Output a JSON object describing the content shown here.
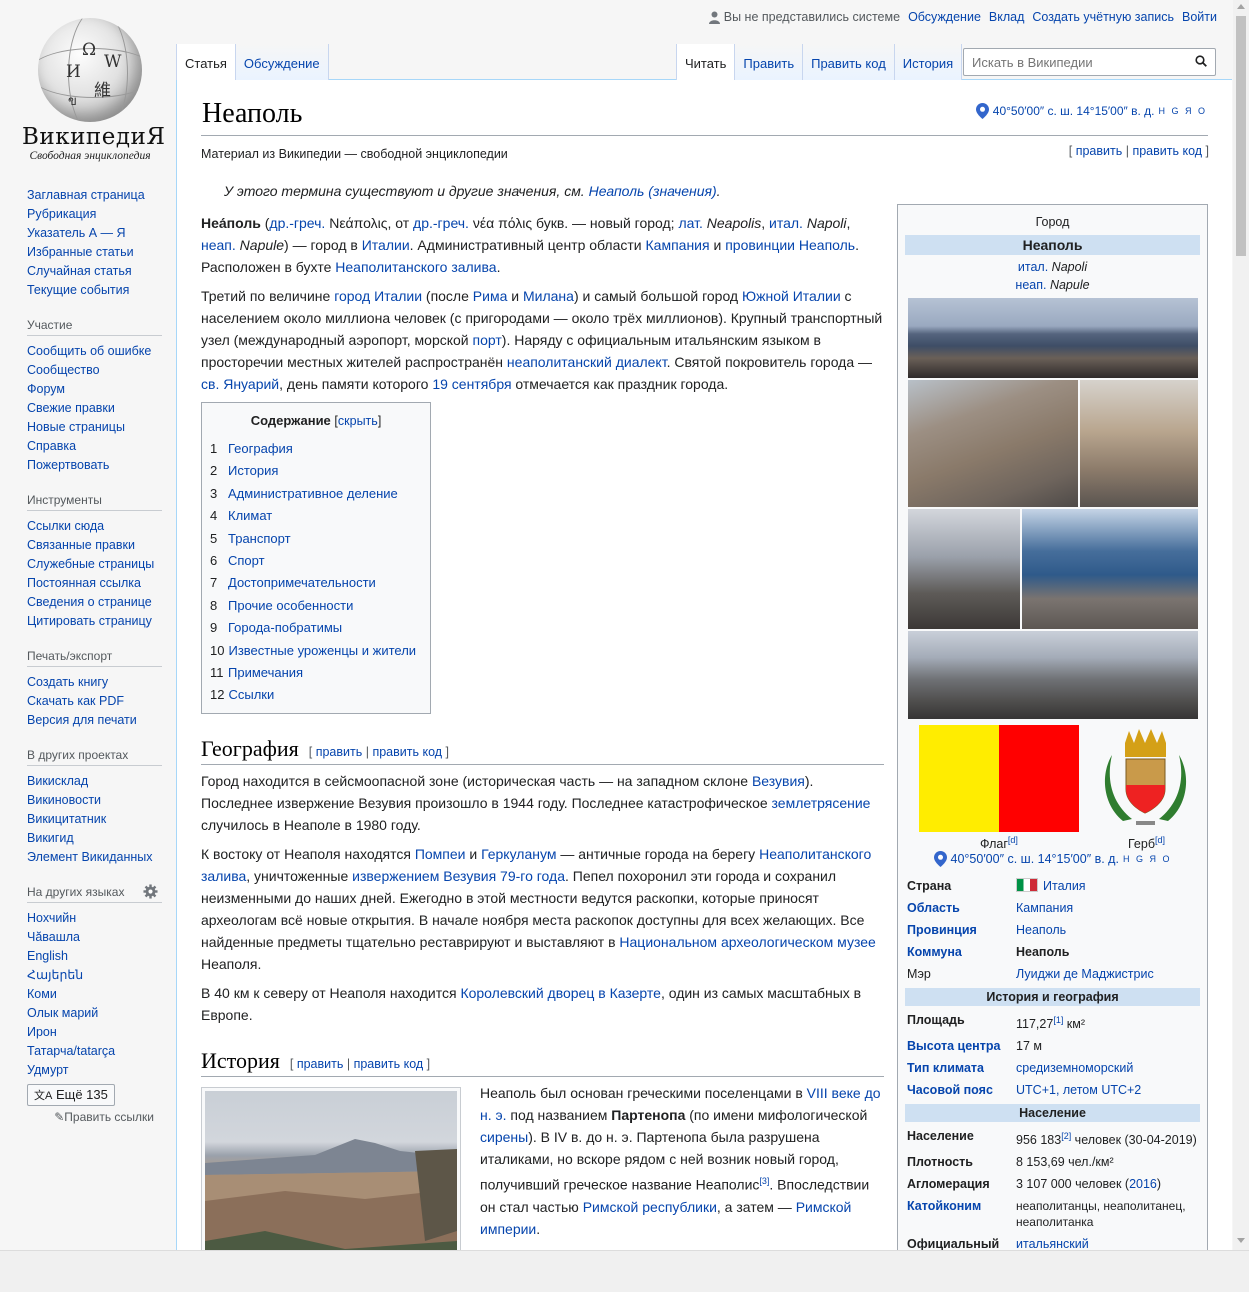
{
  "logo": {
    "wordmark": "ВикипедиЯ",
    "tagline": "Свободная энциклопедия"
  },
  "personal": {
    "not_logged_in": "Вы не представились системе",
    "links": [
      "Обсуждение",
      "Вклад",
      "Создать учётную запись",
      "Войти"
    ]
  },
  "tabs": {
    "article": "Статья",
    "talk": "Обсуждение",
    "read": "Читать",
    "edit": "Править",
    "edit_source": "Править код",
    "history": "История"
  },
  "search": {
    "placeholder": "Искать в Википедии"
  },
  "sidebar": {
    "main": [
      "Заглавная страница",
      "Рубрикация",
      "Указатель А — Я",
      "Избранные статьи",
      "Случайная статья",
      "Текущие события"
    ],
    "participation": {
      "head": "Участие",
      "items": [
        "Сообщить об ошибке",
        "Сообщество",
        "Форум",
        "Свежие правки",
        "Новые страницы",
        "Справка",
        "Пожертвовать"
      ]
    },
    "tools": {
      "head": "Инструменты",
      "items": [
        "Ссылки сюда",
        "Связанные правки",
        "Служебные страницы",
        "Постоянная ссылка",
        "Сведения о странице",
        "Цитировать страницу"
      ]
    },
    "print": {
      "head": "Печать/экспорт",
      "items": [
        "Создать книгу",
        "Скачать как PDF",
        "Версия для печати"
      ]
    },
    "projects": {
      "head": "В других проектах",
      "items": [
        "Викисклад",
        "Викиновости",
        "Викицитатник",
        "Викигид",
        "Элемент Викиданных"
      ]
    },
    "languages": {
      "head": "На других языках",
      "items": [
        "Нохчийн",
        "Чăвашла",
        "English",
        "Հայերեն",
        "Коми",
        "Олык марий",
        "Ирон",
        "Татарча/tatarça",
        "Удмурт"
      ],
      "more": "Ещё 135",
      "edit_links": "Править ссылки"
    }
  },
  "article": {
    "title": "Неаполь",
    "coords": "40°50′00″ с. ш. 14°15′00″ в. д.",
    "coords_sup": "H G Я O",
    "site_sub": "Материал из Википедии — свободной энциклопедии",
    "edit_top": {
      "edit": "править",
      "edit_source": "править код"
    },
    "hatnote_text": "У этого термина существуют и другие значения, см. ",
    "hatnote_link": "Неаполь (значения)",
    "intro": {
      "t0": "Неа́поль",
      "t1": " (",
      "l1": "др.-греч.",
      "t2": " Νεάπολις, от ",
      "l2": "др.-греч.",
      "t3": " νέα πόλις букв. — новый город; ",
      "l3": "лат.",
      "t4": " Neapolis",
      "t5": ", ",
      "l4": "итал.",
      "t6": " Napoli",
      "t7": ", ",
      "l5": "неап.",
      "t8": " Napule",
      "t9": ") — город в ",
      "l6": "Италии",
      "t10": ". Административный центр области ",
      "l7": "Кампания",
      "t11": " и ",
      "l8": "провинции Неаполь",
      "t12": ". Расположен в бухте ",
      "l9": "Неаполитанского залива",
      "t13": "."
    },
    "p2": {
      "t0": "Третий по величине ",
      "l1": "город Италии",
      "t1": " (после ",
      "l2": "Рима",
      "t2": " и ",
      "l3": "Милана",
      "t3": ") и самый большой город ",
      "l4": "Южной Италии",
      "t4": " с населением около миллиона человек (с пригородами — около трёх миллионов). Крупный транспортный узел (международный аэропорт, морской ",
      "l5": "порт",
      "t5": "). Наряду с официальным итальянским языком в просторечии местных жителей распространён ",
      "l6": "неаполитанский диалект",
      "t6": ". Святой покровитель города — ",
      "l7": "св. Януарий",
      "t7": ", день памяти которого ",
      "l8": "19 сентября",
      "t8": " отмечается как праздник города."
    },
    "toc": {
      "title": "Содержание",
      "hide": "скрыть",
      "entries": [
        {
          "n": "1",
          "t": "География"
        },
        {
          "n": "2",
          "t": "История"
        },
        {
          "n": "3",
          "t": "Административное деление"
        },
        {
          "n": "4",
          "t": "Климат"
        },
        {
          "n": "5",
          "t": "Транспорт"
        },
        {
          "n": "6",
          "t": "Спорт"
        },
        {
          "n": "7",
          "t": "Достопримечательности"
        },
        {
          "n": "8",
          "t": "Прочие особенности"
        },
        {
          "n": "9",
          "t": "Города-побратимы"
        },
        {
          "n": "10",
          "t": "Известные уроженцы и жители"
        },
        {
          "n": "11",
          "t": "Примечания"
        },
        {
          "n": "12",
          "t": "Ссылки"
        }
      ]
    },
    "geo": {
      "heading": "География",
      "edit": "править",
      "edit_source": "править код",
      "p1": {
        "t0": "Город находится в сейсмоопасной зоне (историческая часть — на западном склоне ",
        "l1": "Везувия",
        "t1": "). Последнее извержение Везувия произошло в 1944 году. Последнее катастрофическое ",
        "l2": "землетрясение",
        "t2": " случилось в Неаполе в 1980 году."
      },
      "p2": {
        "t0": "К востоку от Неаполя находятся ",
        "l1": "Помпеи",
        "t1": " и ",
        "l2": "Геркуланум",
        "t2": " — античные города на берегу ",
        "l3": "Неаполитанского залива",
        "t3": ", уничтоженные ",
        "l4": "извержением Везувия 79-го года",
        "t4": ". Пепел похоронил эти города и сохранил неизменными до наших дней. Ежегодно в этой местности ведутся раскопки, которые приносят археологам всё новые открытия. В начале ноября места раскопок доступны для всех желающих. Все найденные предметы тщательно реставрируют и выставляют в ",
        "l5": "Национальном археологическом музее",
        "t5": " Неаполя."
      },
      "p3": {
        "t0": "В 40 км к северу от Неаполя находится ",
        "l1": "Королевский дворец в Казерте",
        "t1": ", один из самых масштабных в Европе."
      }
    },
    "history": {
      "heading": "История",
      "edit": "править",
      "edit_source": "править код",
      "p1": {
        "t0": "Неаполь был основан греческими поселенцами в ",
        "l1": "VIII веке до н. э.",
        "t1": " под названием ",
        "b1": "Партенопа",
        "t2": " (по имени мифологической ",
        "l2": "сирены",
        "t3": "). В IV в. до н. э. Партенопа была разрушена италиками, но вскоре рядом с ней возник новый город, получивший греческое название Неаполис",
        "r1": "[3]",
        "t4": ". Впоследствии он стал частью ",
        "l3": "Римской республики",
        "t5": ", а затем — ",
        "l4": "Римской империи",
        "t6": "."
      }
    }
  },
  "infobox": {
    "above": "Город",
    "title": "Неаполь",
    "native1_lang": "итал.",
    "native1": " Napoli",
    "native2_lang": "неап.",
    "native2": " Napule",
    "flag_caption": "Флаг",
    "flag_ref": "[d]",
    "coat_caption": "Герб",
    "coat_ref": "[d]",
    "coords": "40°50′00″ с. ш. 14°15′00″ в. д.",
    "coords_sup": "H G Я O",
    "rows1": [
      {
        "k": "Страна",
        "v": "Италия",
        "kl": false,
        "vl": true,
        "flag": true
      },
      {
        "k": "Область",
        "v": "Кампания",
        "kl": true,
        "vl": true
      },
      {
        "k": "Провинция",
        "v": "Неаполь",
        "kl": true,
        "vl": true
      },
      {
        "k": "Коммуна",
        "v": "Неаполь",
        "kl": true,
        "vl": false,
        "vb": true
      },
      {
        "k": "Мэр",
        "v": "Луиджи де Маджистрис",
        "kl": false,
        "vl": true,
        "knb": true
      }
    ],
    "head_geo": "История и география",
    "rows2": [
      {
        "k": "Площадь",
        "v": "117,27",
        "ref": "[1]",
        "unit": " км²",
        "kl": false,
        "vl": false
      },
      {
        "k": "Высота центра",
        "v": "17 м",
        "kl": true,
        "vl": false
      },
      {
        "k": "Тип климата",
        "v": "средиземноморский",
        "kl": true,
        "vl": true
      },
      {
        "k": "Часовой пояс",
        "v": "UTC+1, летом UTC+2",
        "kl": true,
        "vl": true
      }
    ],
    "head_pop": "Население",
    "rows3": [
      {
        "k": "Население",
        "v": "956 183",
        "ref": "[2]",
        "unit": " человек (30-04-2019)",
        "kl": false,
        "vl": false
      },
      {
        "k": "Плотность",
        "v": "8 153,69 чел./км²",
        "kl": false,
        "vl": false
      },
      {
        "k": "Агломерация",
        "v": "3 107 000 человек (",
        "vlink": "2016",
        "vtail": ")",
        "kl": false,
        "vl": false
      },
      {
        "k": "Катойконим",
        "v": "неаполитанцы, неаполитанец, неаполитанка",
        "kl": true,
        "vl": false,
        "small": true
      },
      {
        "k": "Официальный",
        "v": "итальянский",
        "kl": false,
        "vl": true
      }
    ]
  }
}
